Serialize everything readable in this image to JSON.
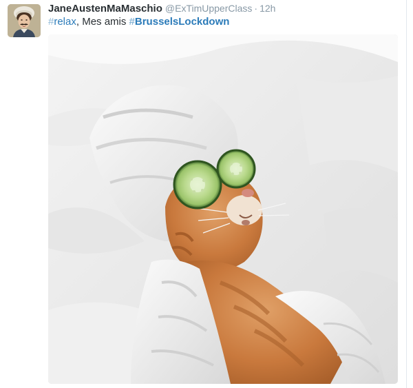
{
  "tweet": {
    "display_name": "JaneAustenMaMaschio",
    "handle": "@ExTimUpperClass",
    "separator": "·",
    "time": "12h",
    "text": {
      "hashtag1_symbol": "#",
      "hashtag1_word": "relax",
      "middle_text": ", Mes amis ",
      "hashtag2_symbol": "#",
      "hashtag2_word": "BrusselsLockdown"
    },
    "avatar_icon": "portrait-avatar-icon",
    "media_icon": "cat-relaxing-photo"
  },
  "colors": {
    "name": "#292f33",
    "meta": "#8899a6",
    "hashtag": "#2b7bb9"
  }
}
